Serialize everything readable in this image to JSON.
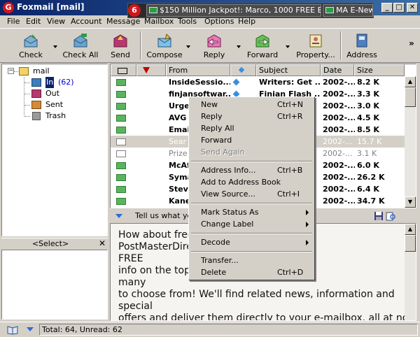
{
  "window": {
    "title": "Foxmail [mail]",
    "logo_glyph": "G",
    "min_glyph": "_",
    "max_glyph": "□",
    "close_glyph": "✕"
  },
  "notifications": {
    "logo_glyph": "6",
    "items": [
      {
        "text": "$150 Million Jackpot!: Marco, 1000 FREE BI..."
      },
      {
        "text": "MA E-New"
      }
    ]
  },
  "menu": {
    "items": [
      "File",
      "Edit",
      "View",
      "Account",
      "Message",
      "Mailbox",
      "Tools",
      "Options",
      "Help"
    ]
  },
  "toolbar": {
    "check": "Check",
    "check_all": "Check All",
    "send": "Send",
    "compose": "Compose",
    "reply": "Reply",
    "forward": "Forward",
    "property": "Property...",
    "address": "Address",
    "more_glyph": "»"
  },
  "folders": {
    "root": "mail",
    "expander_glyph": "−",
    "items": [
      {
        "name": "In",
        "count": "(62)"
      },
      {
        "name": "Out",
        "count": ""
      },
      {
        "name": "Sent",
        "count": ""
      },
      {
        "name": "Trash",
        "count": ""
      }
    ]
  },
  "select_pane": {
    "title": "<Select>",
    "close_glyph": "✕"
  },
  "message_list": {
    "columns": {
      "from": "From",
      "subject": "Subject",
      "date": "Date",
      "size": "Size"
    },
    "rows": [
      {
        "from": "InsideSessio...",
        "subject": "Writers: Get ...",
        "date": "2002-...",
        "size": "8.2 K"
      },
      {
        "from": "finjansoftwar...",
        "subject": "Finjan Flash ...",
        "date": "2002-...",
        "size": "3.3 K"
      },
      {
        "from": "Urge",
        "subject": "",
        "date": "2002-...",
        "size": "3.0 K"
      },
      {
        "from": "AVG",
        "subject": "",
        "date": "2002-...",
        "size": "4.5 K"
      },
      {
        "from": "Emai",
        "subject": "",
        "date": "2002-...",
        "size": "8.5 K"
      },
      {
        "from": "Sear",
        "subject": "",
        "date": "2002-...",
        "size": "15.7 K"
      },
      {
        "from": "Prize",
        "subject": "",
        "date": "2002-...",
        "size": "3.1 K"
      },
      {
        "from": "McAf",
        "subject": "",
        "date": "2002-...",
        "size": "6.0 K"
      },
      {
        "from": "Syma",
        "subject": "",
        "date": "2002-...",
        "size": "26.2 K"
      },
      {
        "from": "Stev",
        "subject": "",
        "date": "2002-...",
        "size": "6.4 K"
      },
      {
        "from": "Kane",
        "subject": "",
        "date": "2002-...",
        "size": "34.7 K"
      }
    ]
  },
  "preview": {
    "header": "Tell us what you",
    "lines": [
      "How about free                                 med up with",
      "PostMasterDire                                  ice, to offer you",
      "FREE",
      "info on the topic                               d there are so",
      "many",
      "to choose from! We'll find related news, information and",
      "special",
      "offers and deliver them directly to your e-mailbox, all at no"
    ]
  },
  "context_menu": {
    "items": [
      {
        "label": "New",
        "key": "Ctrl+N"
      },
      {
        "label": "Reply",
        "key": "Ctrl+R"
      },
      {
        "label": "Reply All",
        "key": ""
      },
      {
        "label": "Forward",
        "key": ""
      },
      {
        "label": "Send Again",
        "key": ""
      },
      {
        "label": "Address Info...",
        "key": "Ctrl+B"
      },
      {
        "label": "Add to Address Book",
        "key": ""
      },
      {
        "label": "View Source...",
        "key": "Ctrl+I"
      },
      {
        "label": "Mark Status As",
        "key": ""
      },
      {
        "label": "Change Label",
        "key": ""
      },
      {
        "label": "Decode",
        "key": ""
      },
      {
        "label": "Transfer...",
        "key": ""
      },
      {
        "label": "Delete",
        "key": "Ctrl+D"
      }
    ]
  },
  "status": {
    "text": "Total: 64, Unread: 62"
  },
  "colors": {
    "title_start": "#0a246a",
    "title_end": "#3a6ea5",
    "unread_count": "#0000cc"
  }
}
